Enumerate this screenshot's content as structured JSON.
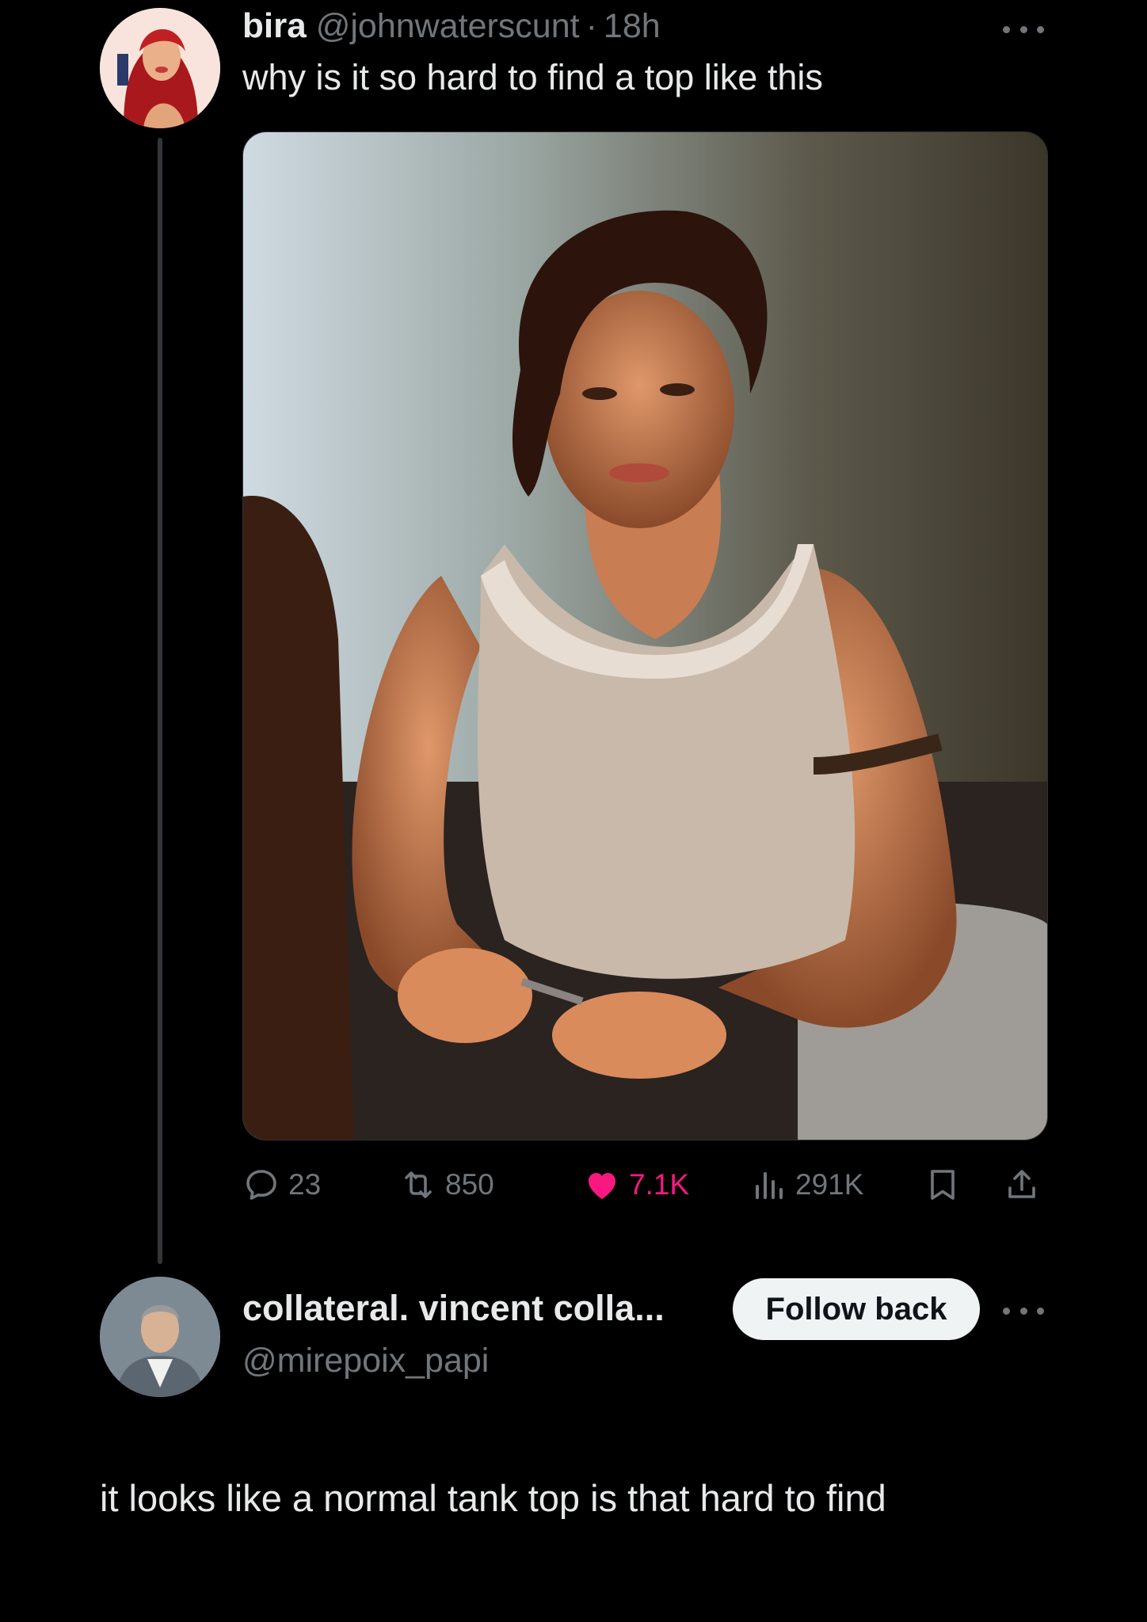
{
  "tweet": {
    "author_name": "bira",
    "author_handle": "@johnwaterscunt",
    "separator": "·",
    "time": "18h",
    "text": "why is it so hard to find a top like this",
    "stats": {
      "replies": "23",
      "reposts": "850",
      "likes": "7.1K",
      "views": "291K"
    },
    "icons": {
      "reply": "reply-icon",
      "repost": "repost-icon",
      "like": "heart-icon",
      "views": "views-icon",
      "bookmark": "bookmark-icon",
      "share": "share-icon",
      "more": "more-icon"
    }
  },
  "reply": {
    "author_name": "collateral. vincent colla...",
    "author_handle": "@mirepoix_papi",
    "follow_label": "Follow back",
    "text": "it looks like a normal tank top is that hard to find"
  },
  "colors": {
    "background": "#000000",
    "primary_text": "#e7e9ea",
    "secondary_text": "#71767b",
    "like": "#f91880",
    "button_bg": "#eff3f4"
  }
}
